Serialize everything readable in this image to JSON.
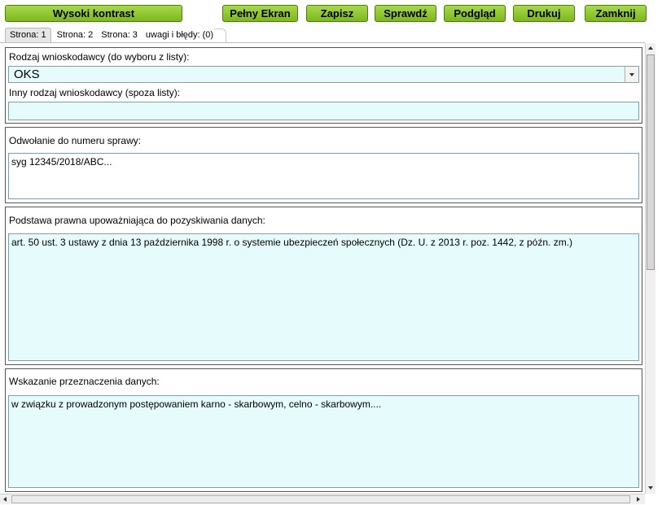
{
  "toolbar": {
    "high_contrast": "Wysoki kontrast",
    "fullscreen": "Pełny Ekran",
    "save": "Zapisz",
    "check": "Sprawdź",
    "preview": "Podgląd",
    "print": "Drukuj",
    "close": "Zamknij"
  },
  "tabs": [
    "Strona: 1",
    "Strona: 2",
    "Strona: 3",
    "uwagi i błędy: (0)"
  ],
  "active_tab": 0,
  "form": {
    "applicant_type_label": "Rodzaj wnioskodawcy (do wyboru z listy):",
    "applicant_type_value": "OKS",
    "other_applicant_label": "Inny rodzaj wnioskodawcy (spoza listy):",
    "other_applicant_value": "",
    "case_ref_label": "Odwołanie do numeru sprawy:",
    "case_ref_value": "syg 12345/2018/ABC...",
    "legal_basis_label": "Podstawa prawna upoważniająca do pozyskiwania danych:",
    "legal_basis_value": "art. 50 ust. 3 ustawy z dnia 13 października 1998 r. o systemie ubezpieczeń społecznych (Dz. U. z 2013 r. poz. 1442, z późn. zm.)",
    "purpose_label": "Wskazanie przeznaczenia danych:",
    "purpose_value": "w związku z prowadzonym postępowaniem karno - skarbowym, celno - skarbowym...."
  },
  "colors": {
    "button_green": "#8cc63f",
    "field_cyan": "#e6fcfc"
  }
}
